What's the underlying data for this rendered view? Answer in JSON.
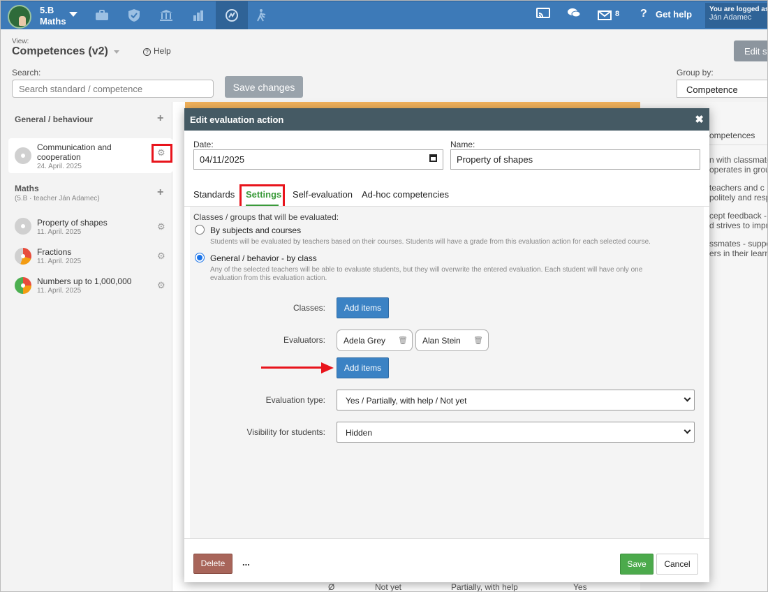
{
  "topbar": {
    "class_name": "5.B",
    "subject": "Maths",
    "nav_icons": [
      "briefcase-icon",
      "shield-icon",
      "institution-icon",
      "bar-chart-icon",
      "competence-icon",
      "hiking-icon"
    ],
    "messages_count": "8",
    "get_help": "Get help",
    "user_logged": "You are logged as",
    "user_name": "Ján Adamec"
  },
  "header": {
    "view_label": "View:",
    "view_title": "Competences (v2)",
    "help": "Help",
    "search_label": "Search:",
    "search_placeholder": "Search standard / competence",
    "save_changes": "Save changes",
    "edit_button": "Edit st",
    "group_by_label": "Group by:",
    "group_by_value": "Competence"
  },
  "sidebar": {
    "group1": "General / behaviour",
    "group1_items": [
      {
        "title_l1": "Communication and",
        "title_l2": "cooperation",
        "date": "24. April. 2025"
      }
    ],
    "group2": "Maths",
    "group2_sub": "(5.B · teacher Ján Adamec)",
    "group2_items": [
      {
        "title": "Property of shapes",
        "date": "11. April. 2025"
      },
      {
        "title": "Fractions",
        "date": "11. April. 2025"
      },
      {
        "title": "Numbers up to 1,000,000",
        "date": "11. April. 2025"
      }
    ]
  },
  "right_panel": {
    "tab": "ompetences",
    "lines": [
      "n with classmate",
      "operates in grou",
      "teachers and c",
      "politely and resp",
      "cept feedback -",
      "d strives to impr",
      "ssmates - suppo",
      "ers in their learn"
    ]
  },
  "background_row": {
    "symbol": "Ø",
    "not_yet": "Not yet",
    "partially": "Partially, with help",
    "yes": "Yes"
  },
  "modal": {
    "title": "Edit evaluation action",
    "date_label": "Date:",
    "date_value": "04/11/2025",
    "name_label": "Name:",
    "name_value": "Property of shapes",
    "tabs": [
      "Standards",
      "Settings",
      "Self-evaluation",
      "Ad-hoc competencies"
    ],
    "section_title": "Classes / groups that will be evaluated:",
    "option1_label": "By subjects and courses",
    "option1_desc": "Students will be evaluated by teachers based on their courses. Students will have a grade from this evaluation action for each selected course.",
    "option2_label": "General / behavior - by class",
    "option2_desc_l1": "Any of the selected teachers will be able to evaluate students, but they will overwrite the entered evaluation. Each student will have only one",
    "option2_desc_l2": "evaluation from this evaluation action.",
    "classes_label": "Classes:",
    "add_items": "Add items",
    "evaluators_label": "Evaluators:",
    "evaluators": [
      "Adela Grey",
      "Alan Stein"
    ],
    "eval_type_label": "Evaluation type:",
    "eval_type_value": "Yes / Partially, with help / Not yet",
    "visibility_label": "Visibility for students:",
    "visibility_value": "Hidden",
    "delete": "Delete",
    "more": "...",
    "save": "Save",
    "cancel": "Cancel"
  }
}
